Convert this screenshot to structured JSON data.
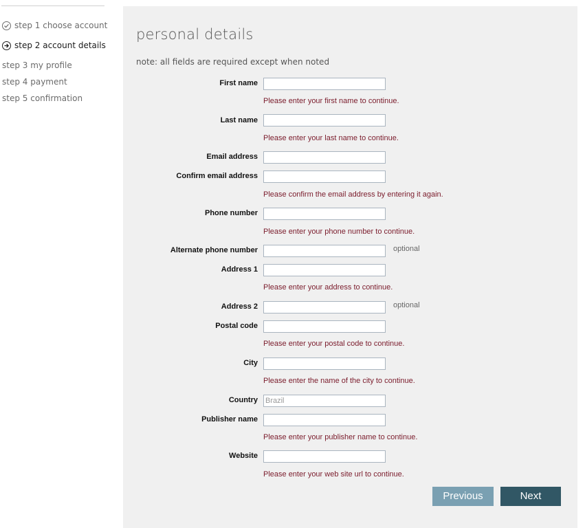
{
  "sidebar": {
    "steps": [
      {
        "label": "step 1 choose account",
        "status": "done"
      },
      {
        "label": "step 2 account details",
        "status": "current"
      },
      {
        "label": "step 3 my profile",
        "status": "upcoming"
      },
      {
        "label": "step 4 payment",
        "status": "upcoming"
      },
      {
        "label": "step 5 confirmation",
        "status": "upcoming"
      }
    ]
  },
  "form": {
    "title": "personal details",
    "note": "note: all fields are required except when noted",
    "fields": [
      {
        "label": "First name",
        "value": "",
        "error": "Please enter your first name to continue.",
        "optional": ""
      },
      {
        "label": "Last name",
        "value": "",
        "error": "Please enter your last name to continue.",
        "optional": ""
      },
      {
        "label": "Email address",
        "value": "",
        "error": "",
        "optional": ""
      },
      {
        "label": "Confirm email address",
        "value": "",
        "error": "Please confirm the email address by entering it again.",
        "optional": ""
      },
      {
        "label": "Phone number",
        "value": "",
        "error": "Please enter your phone number to continue.",
        "optional": ""
      },
      {
        "label": "Alternate phone number",
        "value": "",
        "error": "",
        "optional": "optional"
      },
      {
        "label": "Address 1",
        "value": "",
        "error": "Please enter your address to continue.",
        "optional": ""
      },
      {
        "label": "Address 2",
        "value": "",
        "error": "",
        "optional": "optional"
      },
      {
        "label": "Postal code",
        "value": "",
        "error": "Please enter your postal code to continue.",
        "optional": ""
      },
      {
        "label": "City",
        "value": "",
        "error": "Please enter the name of the city to continue.",
        "optional": ""
      },
      {
        "label": "Country",
        "value": "Brazil",
        "error": "",
        "optional": ""
      },
      {
        "label": "Publisher name",
        "value": "",
        "error": "Please enter your publisher name to continue.",
        "optional": ""
      },
      {
        "label": "Website",
        "value": "",
        "error": "Please enter your web site url to continue.",
        "optional": ""
      }
    ]
  },
  "buttons": {
    "previous": "Previous",
    "next": "Next"
  },
  "colors": {
    "error": "#7a1b2b",
    "next_button": "#315765",
    "previous_button": "#7aa0b2",
    "panel": "#f0f0f0"
  }
}
